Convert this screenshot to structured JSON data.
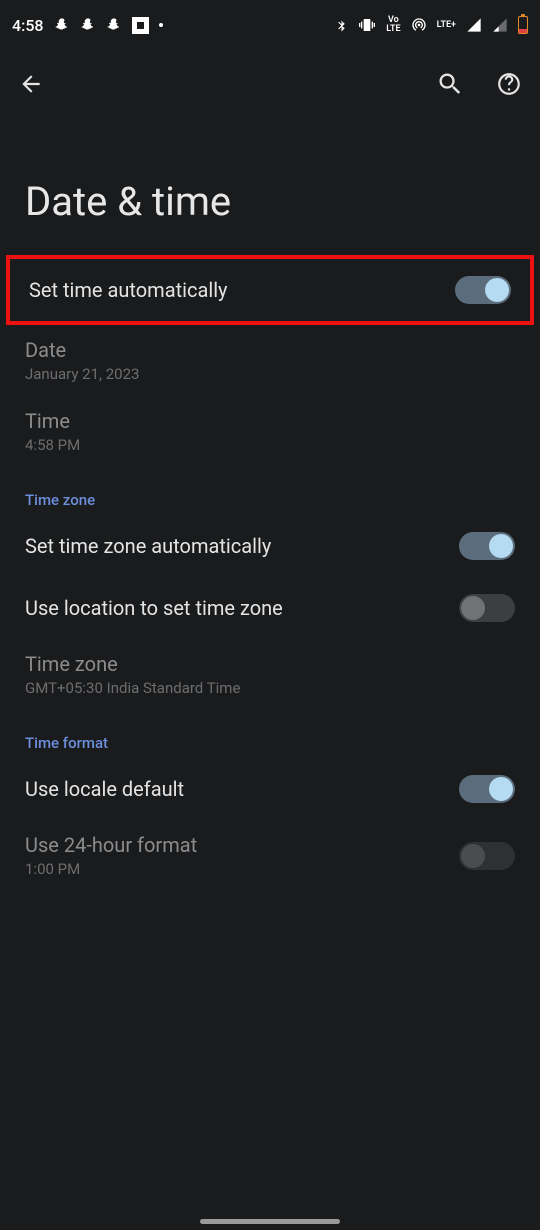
{
  "status": {
    "clock": "4:58",
    "lte_label": "LTE+",
    "vo_label": "Vo",
    "lte_small": "LTE"
  },
  "page": {
    "title": "Date & time"
  },
  "settings": {
    "set_time_auto": {
      "title": "Set time automatically"
    },
    "date": {
      "title": "Date",
      "sub": "January 21, 2023"
    },
    "time": {
      "title": "Time",
      "sub": "4:58 PM"
    },
    "section_timezone": "Time zone",
    "set_tz_auto": {
      "title": "Set time zone automatically"
    },
    "use_location_tz": {
      "title": "Use location to set time zone"
    },
    "timezone": {
      "title": "Time zone",
      "sub": "GMT+05:30 India Standard Time"
    },
    "section_timeformat": "Time format",
    "use_locale_default": {
      "title": "Use locale default"
    },
    "use_24h": {
      "title": "Use 24-hour format",
      "sub": "1:00 PM"
    }
  }
}
